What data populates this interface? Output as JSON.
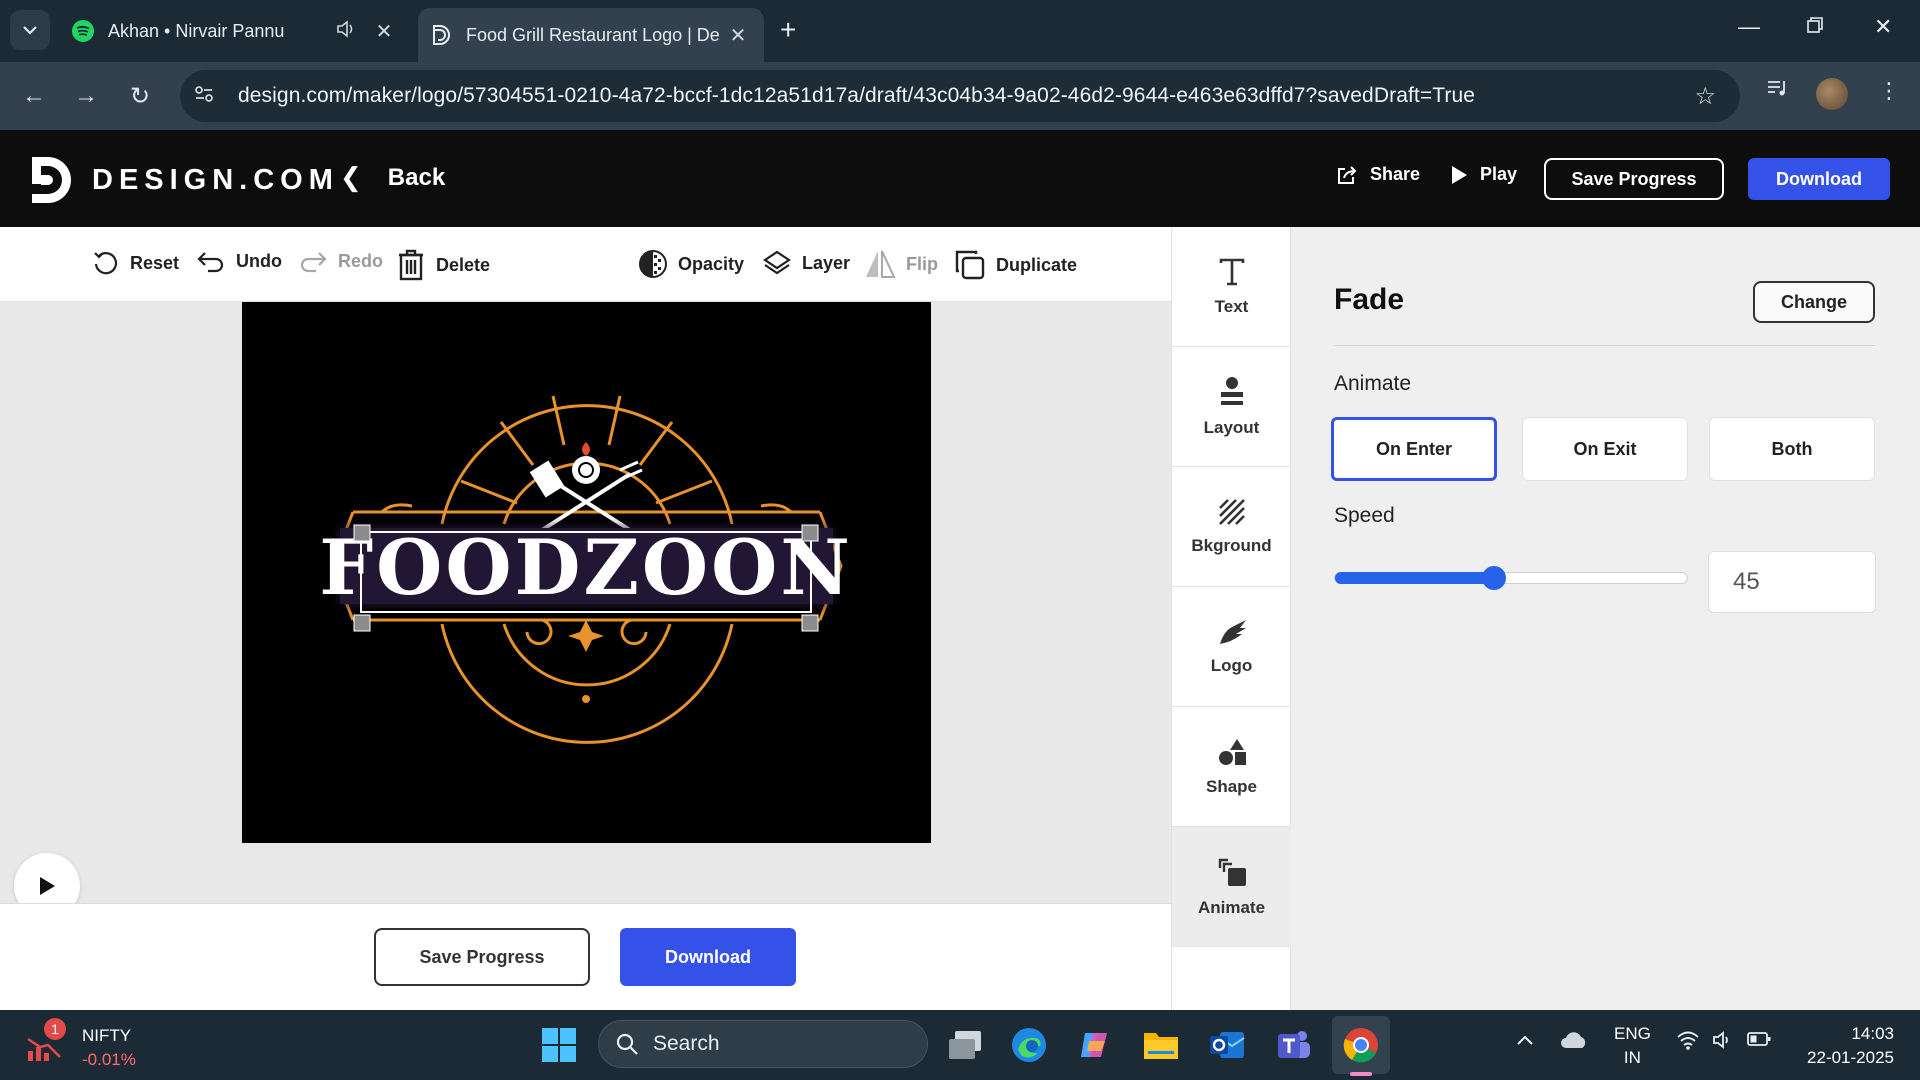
{
  "browser": {
    "tabs": [
      {
        "title": "Akhan • Nirvair Pannu",
        "icon": "spotify-icon",
        "active": false
      },
      {
        "title": "Food Grill Restaurant Logo | De",
        "icon": "design-com-icon",
        "active": true
      }
    ],
    "url": "design.com/maker/logo/57304551-0210-4a72-bccf-1dc12a51d17a/draft/43c04b34-9a02-46d2-9644-e463e63dffd7?savedDraft=True"
  },
  "header": {
    "brand": "DESIGN.COM",
    "back_label": "Back",
    "share_label": "Share",
    "play_label": "Play",
    "save_label": "Save Progress",
    "download_label": "Download"
  },
  "toolbar": {
    "reset": "Reset",
    "undo": "Undo",
    "redo": "Redo",
    "delete": "Delete",
    "opacity": "Opacity",
    "layer": "Layer",
    "flip": "Flip",
    "duplicate": "Duplicate"
  },
  "logo": {
    "text": "FOODZOON",
    "accent": "#e8922e"
  },
  "bottom": {
    "save_label": "Save Progress",
    "download_label": "Download"
  },
  "rail": [
    {
      "label": "Text",
      "icon": "text-icon"
    },
    {
      "label": "Layout",
      "icon": "layout-icon"
    },
    {
      "label": "Bkground",
      "icon": "background-icon"
    },
    {
      "label": "Logo",
      "icon": "logo-icon"
    },
    {
      "label": "Shape",
      "icon": "shape-icon"
    },
    {
      "label": "Animate",
      "icon": "animate-icon"
    }
  ],
  "panel": {
    "title": "Fade",
    "change_label": "Change",
    "animate_label": "Animate",
    "options": [
      "On Enter",
      "On Exit",
      "Both"
    ],
    "selected_option": "On Enter",
    "speed_label": "Speed",
    "speed_value": "45",
    "speed_fraction": 0.45
  },
  "taskbar": {
    "ticker_name": "NIFTY",
    "ticker_change": "-0.01%",
    "notification_count": "1",
    "search_label": "Search",
    "lang_line1": "ENG",
    "lang_line2": "IN",
    "time": "14:03",
    "date": "22-01-2025"
  },
  "colors": {
    "accent_blue": "#3552e8",
    "header_bg": "#0d0d0d",
    "slider_blue": "#2563eb"
  }
}
